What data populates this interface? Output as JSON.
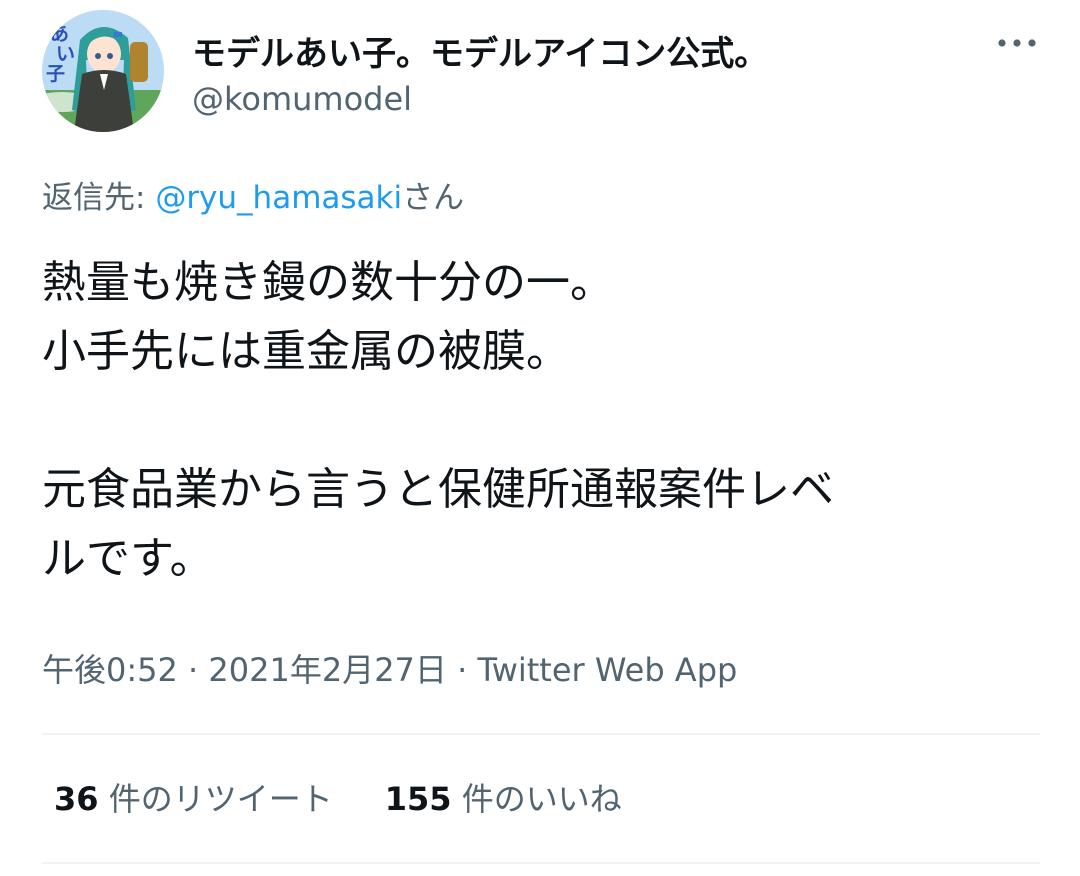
{
  "author": {
    "display_name": "モデルあい子。モデルアイコン公式。",
    "handle": "@komumodel",
    "avatar": {
      "icon": "anime-character-avatar",
      "text": "あい子"
    }
  },
  "menu": {
    "icon": "more-horizontal-icon"
  },
  "reply": {
    "prefix": "返信先: ",
    "mention": "@ryu_hamasaki",
    "suffix": "さん"
  },
  "tweet": {
    "lines": [
      "熱量も焼き鏝の数十分の一。",
      "小手先には重金属の被膜。",
      "",
      "元食品業から言うと保健所通報案件レベ",
      "ルです。"
    ]
  },
  "meta": {
    "time": "午後0:52",
    "separator1": " · ",
    "date": "2021年2月27日",
    "separator2": " · ",
    "source": "Twitter Web App"
  },
  "stats": {
    "retweets_count": "36",
    "retweets_label": " 件のリツイート",
    "likes_count": "155",
    "likes_label": " 件のいいね"
  },
  "colors": {
    "text": "#0f1419",
    "secondary": "#536471",
    "link": "#1d9bf0",
    "divider": "#eff3f4"
  }
}
